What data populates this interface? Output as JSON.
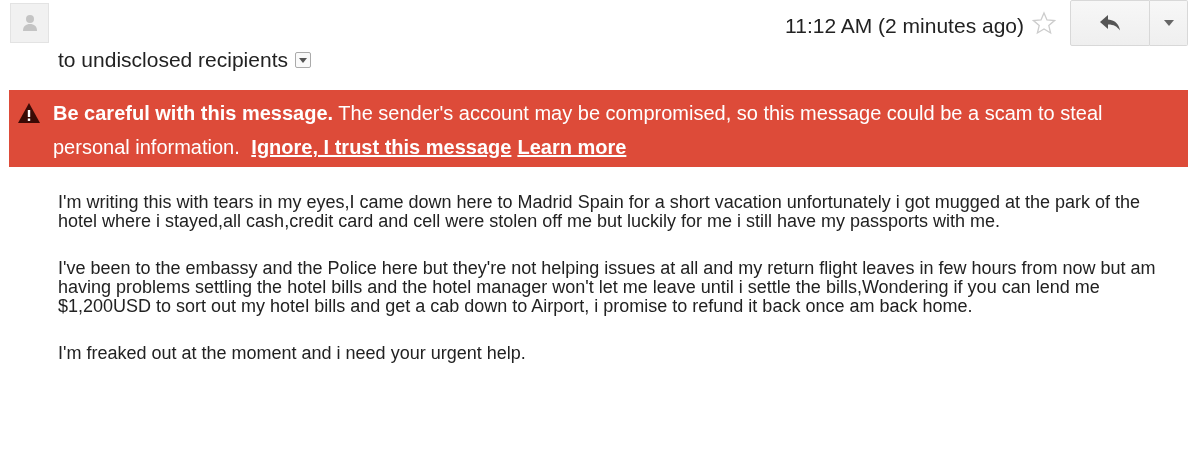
{
  "header": {
    "time": "11:12 AM (2 minutes ago)",
    "starred": false,
    "recipients": "to undisclosed recipients"
  },
  "warning": {
    "text": "**Be careful with this message.** The sender's account may be compromised, so this message could be a scam to steal personal information.",
    "links": [
      "Ignore, I trust this message",
      "Learn more"
    ]
  },
  "body": [
    "I'm writing this with tears in my eyes,I came down here to Madrid Spain for a short vacation unfortunately i got mugged at the park of the hotel where i stayed,all cash,credit card and cell were stolen off me but luckily for me i still have my passports with me.",
    "I've been to the embassy and the Police here but they're not helping issues at all and my return flight leaves in few hours from now but am having problems settling the hotel bills and the hotel manager won't let me leave until i settle the bills,Wondering if you can lend me $1,200USD to sort out my hotel bills and get a cab down to Airport, i promise to refund it back once am back home.",
    "I'm freaked out at the moment and i need your urgent help."
  ]
}
